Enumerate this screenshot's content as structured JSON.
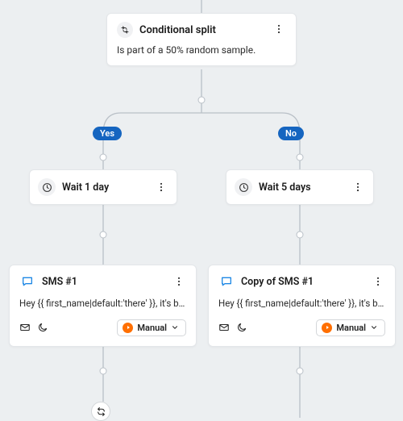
{
  "conditional": {
    "title": "Conditional split",
    "description": "Is part of a 50% random sample."
  },
  "branches": {
    "yes_label": "Yes",
    "no_label": "No"
  },
  "wait": {
    "yes": {
      "title": "Wait 1 day"
    },
    "no": {
      "title": "Wait 5 days"
    }
  },
  "sms": {
    "yes": {
      "title": "SMS #1",
      "body": "Hey {{ first_name|default:'there' }}, it's be…",
      "mode": "Manual"
    },
    "no": {
      "title": "Copy of SMS #1",
      "body": "Hey {{ first_name|default:'there' }}, it's be…",
      "mode": "Manual"
    }
  }
}
